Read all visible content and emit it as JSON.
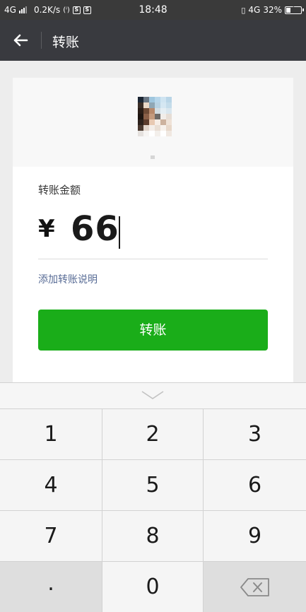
{
  "status_bar": {
    "network_left": "4G",
    "speed": "0.2K/s",
    "time": "18:48",
    "network_right": "4G",
    "battery": "32%",
    "battery_level": 0.32
  },
  "header": {
    "title": "转账"
  },
  "card": {
    "amount_label": "转账金额",
    "currency_symbol": "¥",
    "amount": "66",
    "add_note_link": "添加转账说明",
    "transfer_button": "转账"
  },
  "keypad": {
    "keys": [
      "1",
      "2",
      "3",
      "4",
      "5",
      "6",
      "7",
      "8",
      "9",
      ".",
      "0"
    ]
  },
  "colors": {
    "primary_green": "#1aad19",
    "header_bg": "#393a3f",
    "link_blue": "#576b95"
  },
  "icons": {
    "back": "back-arrow-icon",
    "collapse": "chevron-down-icon",
    "delete": "backspace-icon"
  }
}
